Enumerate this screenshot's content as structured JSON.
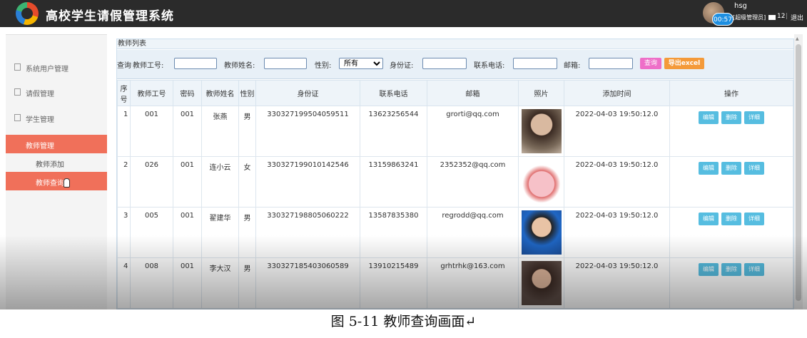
{
  "header": {
    "title": "高校学生请假管理系统",
    "user_name": "hsg",
    "user_role": "[超级管理员]",
    "timer": "00:57",
    "mail_count": "12",
    "separator": "|",
    "logout": "退出"
  },
  "sidebar": {
    "items": [
      {
        "label": "系统用户管理"
      },
      {
        "label": "请假管理"
      },
      {
        "label": "学生管理"
      },
      {
        "label": "教师管理"
      }
    ],
    "sub_items": [
      {
        "label": "教师添加"
      },
      {
        "label": "教师查询"
      }
    ]
  },
  "panel": {
    "title": "教师列表"
  },
  "search": {
    "query_label": "查询",
    "teacher_no_label": "教师工号:",
    "teacher_name_label": "教师姓名:",
    "gender_label": "性别:",
    "gender_selected": "所有",
    "id_label": "身份证:",
    "phone_label": "联系电话:",
    "email_label": "邮箱:",
    "query_button": "查询",
    "export_button": "导出excel"
  },
  "table": {
    "headers": [
      "序号",
      "教师工号",
      "密码",
      "教师姓名",
      "性别",
      "身份证",
      "联系电话",
      "邮箱",
      "照片",
      "添加时间",
      "操作"
    ],
    "rows": [
      {
        "sn": "1",
        "no": "001",
        "pwd": "001",
        "name": "张燕",
        "gender": "男",
        "id": "330327199504059511",
        "phone": "13623256544",
        "email": "grorti@qq.com",
        "time": "2022-04-03 19:50:12.0"
      },
      {
        "sn": "2",
        "no": "026",
        "pwd": "001",
        "name": "连小云",
        "gender": "女",
        "id": "330327199010142546",
        "phone": "13159863241",
        "email": "2352352@qq.com",
        "time": "2022-04-03 19:50:12.0"
      },
      {
        "sn": "3",
        "no": "005",
        "pwd": "001",
        "name": "翟建华",
        "gender": "男",
        "id": "330327198805060222",
        "phone": "13587835380",
        "email": "regrodd@qq.com",
        "time": "2022-04-03 19:50:12.0"
      },
      {
        "sn": "4",
        "no": "008",
        "pwd": "001",
        "name": "李大汉",
        "gender": "男",
        "id": "330327185403060589",
        "phone": "13910215489",
        "email": "grhtrhk@163.com",
        "time": "2022-04-03 19:50:12.0"
      }
    ],
    "op_edit": "编辑",
    "op_delete": "删除",
    "op_detail": "详细"
  },
  "caption": "图 5-11  教师查询画面↵",
  "colors": {
    "accent": "#f0705a",
    "op_button": "#56bde0",
    "query_button": "#ee6fc8",
    "export_button": "#f49a3a"
  }
}
